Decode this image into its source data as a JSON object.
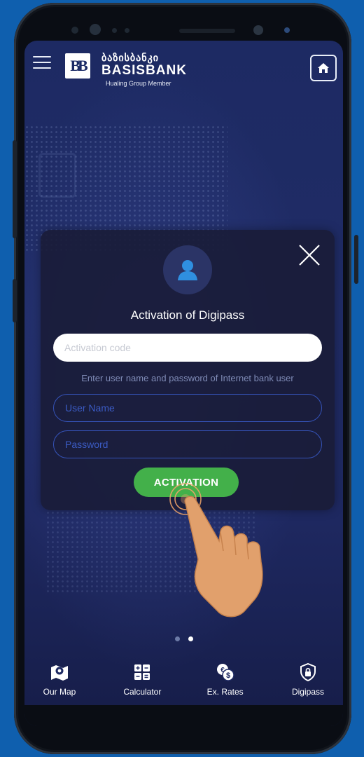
{
  "header": {
    "menu_icon": "hamburger-icon",
    "logo": {
      "geo_name": "ბაზისბანკი",
      "en_name": "BASISBANK",
      "subtitle": "Hualing Group Member",
      "mark": "BB"
    },
    "home_icon": "home-icon"
  },
  "modal": {
    "avatar_icon": "user-icon",
    "close_icon": "close-icon",
    "title": "Activation of Digipass",
    "activation_code": {
      "value": "",
      "placeholder": "Activation code"
    },
    "hint": "Enter user name and password of Internet bank user",
    "username": {
      "value": "",
      "placeholder": "User Name"
    },
    "password": {
      "value": "",
      "placeholder": "Password"
    },
    "submit_label": "ACTIVATION"
  },
  "pager": {
    "count": 2,
    "active_index": 1
  },
  "bottom_nav": {
    "items": [
      {
        "label": "Our Map",
        "icon": "map-icon"
      },
      {
        "label": "Calculator",
        "icon": "calculator-icon"
      },
      {
        "label": "Ex. Rates",
        "icon": "exchange-rates-icon"
      },
      {
        "label": "Digipass",
        "icon": "shield-lock-icon"
      }
    ]
  },
  "colors": {
    "background": "#0f5fae",
    "screen": "#1e2a63",
    "accent_green": "#43b04a",
    "input_border": "#3553b8"
  }
}
